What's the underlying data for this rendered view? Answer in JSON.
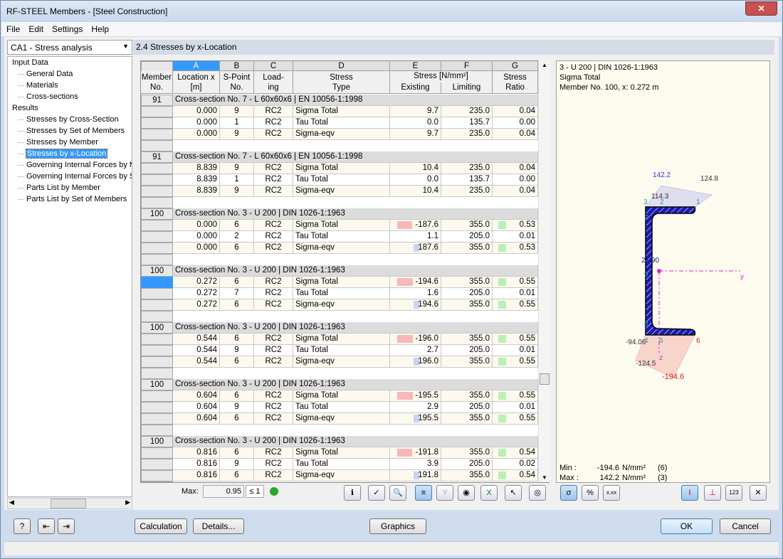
{
  "window": {
    "title": "RF-STEEL Members - [Steel Construction]",
    "close": "✕"
  },
  "menu": [
    "File",
    "Edit",
    "Settings",
    "Help"
  ],
  "case_select": "CA1 - Stress analysis",
  "tree": [
    {
      "label": "Input Data",
      "level": 1
    },
    {
      "label": "General Data",
      "level": 2
    },
    {
      "label": "Materials",
      "level": 2
    },
    {
      "label": "Cross-sections",
      "level": 2
    },
    {
      "label": "Results",
      "level": 1
    },
    {
      "label": "Stresses by Cross-Section",
      "level": 2
    },
    {
      "label": "Stresses by Set of Members",
      "level": 2
    },
    {
      "label": "Stresses by Member",
      "level": 2
    },
    {
      "label": "Stresses by x-Location",
      "level": 2,
      "selected": true
    },
    {
      "label": "Governing Internal Forces by M",
      "level": 2
    },
    {
      "label": "Governing Internal Forces by Se",
      "level": 2
    },
    {
      "label": "Parts List by Member",
      "level": 2
    },
    {
      "label": "Parts List by Set of Members",
      "level": 2
    }
  ],
  "panel_title": "2.4 Stresses by x-Location",
  "table": {
    "col_letters": [
      "A",
      "B",
      "C",
      "D",
      "E",
      "F",
      "G"
    ],
    "headers": {
      "member": "Member No.",
      "location": "Location x [m]",
      "spoint": "S-Point No.",
      "loading": "Load- ing",
      "stress_type": "Stress Type",
      "stress": "Stress [N/mm²]",
      "existing": "Existing",
      "limiting": "Limiting",
      "ratio": "Stress Ratio"
    },
    "groups": [
      {
        "member": "91",
        "section": "Cross-section No.  7 - L 60x60x6 | EN 10056-1:1998",
        "rows": [
          [
            "0.000",
            "9",
            "RC2",
            "Sigma Total",
            "9.7",
            "235.0",
            "0.04"
          ],
          [
            "0.000",
            "1",
            "RC2",
            "Tau Total",
            "0.0",
            "135.7",
            "0.00"
          ],
          [
            "0.000",
            "9",
            "RC2",
            "Sigma-eqv",
            "9.7",
            "235.0",
            "0.04"
          ]
        ]
      },
      {
        "member": "91",
        "section": "Cross-section No.  7 - L 60x60x6 | EN 10056-1:1998",
        "rows": [
          [
            "8.839",
            "9",
            "RC2",
            "Sigma Total",
            "10.4",
            "235.0",
            "0.04"
          ],
          [
            "8.839",
            "1",
            "RC2",
            "Tau Total",
            "0.0",
            "135.7",
            "0.00"
          ],
          [
            "8.839",
            "9",
            "RC2",
            "Sigma-eqv",
            "10.4",
            "235.0",
            "0.04"
          ]
        ]
      },
      {
        "member": "100",
        "section": "Cross-section No.  3 - U 200 | DIN 1026-1:1963",
        "rows": [
          [
            "0.000",
            "6",
            "RC2",
            "Sigma Total",
            "-187.6",
            "355.0",
            "0.53"
          ],
          [
            "0.000",
            "2",
            "RC2",
            "Tau Total",
            "1.1",
            "205.0",
            "0.01"
          ],
          [
            "0.000",
            "6",
            "RC2",
            "Sigma-eqv",
            "187.6",
            "355.0",
            "0.53"
          ]
        ]
      },
      {
        "member": "100",
        "section": "Cross-section No.  3 - U 200 | DIN 1026-1:1963",
        "rows": [
          [
            "0.272",
            "6",
            "RC2",
            "Sigma Total",
            "-194.6",
            "355.0",
            "0.55"
          ],
          [
            "0.272",
            "7",
            "RC2",
            "Tau Total",
            "1.6",
            "205.0",
            "0.01"
          ],
          [
            "0.272",
            "6",
            "RC2",
            "Sigma-eqv",
            "194.6",
            "355.0",
            "0.55"
          ]
        ]
      },
      {
        "member": "100",
        "section": "Cross-section No.  3 - U 200 | DIN 1026-1:1963",
        "rows": [
          [
            "0.544",
            "6",
            "RC2",
            "Sigma Total",
            "-196.0",
            "355.0",
            "0.55"
          ],
          [
            "0.544",
            "9",
            "RC2",
            "Tau Total",
            "2.7",
            "205.0",
            "0.01"
          ],
          [
            "0.544",
            "6",
            "RC2",
            "Sigma-eqv",
            "196.0",
            "355.0",
            "0.55"
          ]
        ]
      },
      {
        "member": "100",
        "section": "Cross-section No.  3 - U 200 | DIN 1026-1:1963",
        "rows": [
          [
            "0.604",
            "6",
            "RC2",
            "Sigma Total",
            "-195.5",
            "355.0",
            "0.55"
          ],
          [
            "0.604",
            "9",
            "RC2",
            "Tau Total",
            "2.9",
            "205.0",
            "0.01"
          ],
          [
            "0.604",
            "6",
            "RC2",
            "Sigma-eqv",
            "195.5",
            "355.0",
            "0.55"
          ]
        ]
      },
      {
        "member": "100",
        "section": "Cross-section No.  3 - U 200 | DIN 1026-1:1963",
        "rows": [
          [
            "0.816",
            "6",
            "RC2",
            "Sigma Total",
            "-191.8",
            "355.0",
            "0.54"
          ],
          [
            "0.816",
            "9",
            "RC2",
            "Tau Total",
            "3.9",
            "205.0",
            "0.02"
          ],
          [
            "0.816",
            "6",
            "RC2",
            "Sigma-eqv",
            "191.8",
            "355.0",
            "0.54"
          ]
        ]
      }
    ]
  },
  "footer": {
    "max_label": "Max:",
    "max_value": "0.95",
    "limit": "≤ 1"
  },
  "graphic": {
    "line1": "3 - U 200 | DIN 1026-1:1963",
    "line2": "Sigma Total",
    "line3": "Member No. 100, x: 0.272 m",
    "labels": {
      "top_max": "142.2",
      "top_right": "124.8",
      "top_mid": "114.3",
      "web": "27.90",
      "bl": "-94.06",
      "b2": "-124.5",
      "bmin": "-194.6",
      "y": "y",
      "z": "z"
    },
    "points": [
      "3",
      "2",
      "1",
      "7",
      "9",
      "8",
      "4",
      "5",
      "6"
    ],
    "min_label": "Min  :",
    "min_value": "-194.6",
    "max_label": "Max :",
    "max_value": "142.2",
    "unit": "N/mm²",
    "min_point": "(6)",
    "max_point": "(3)"
  },
  "buttons": {
    "calculation": "Calculation",
    "details": "Details...",
    "graphics": "Graphics",
    "ok": "OK",
    "cancel": "Cancel"
  },
  "colors": {
    "negative": "#f7b8b8",
    "equivalent": "#c8d4f4",
    "ratio": "#b8f0b8",
    "selected": "#3399ff"
  }
}
